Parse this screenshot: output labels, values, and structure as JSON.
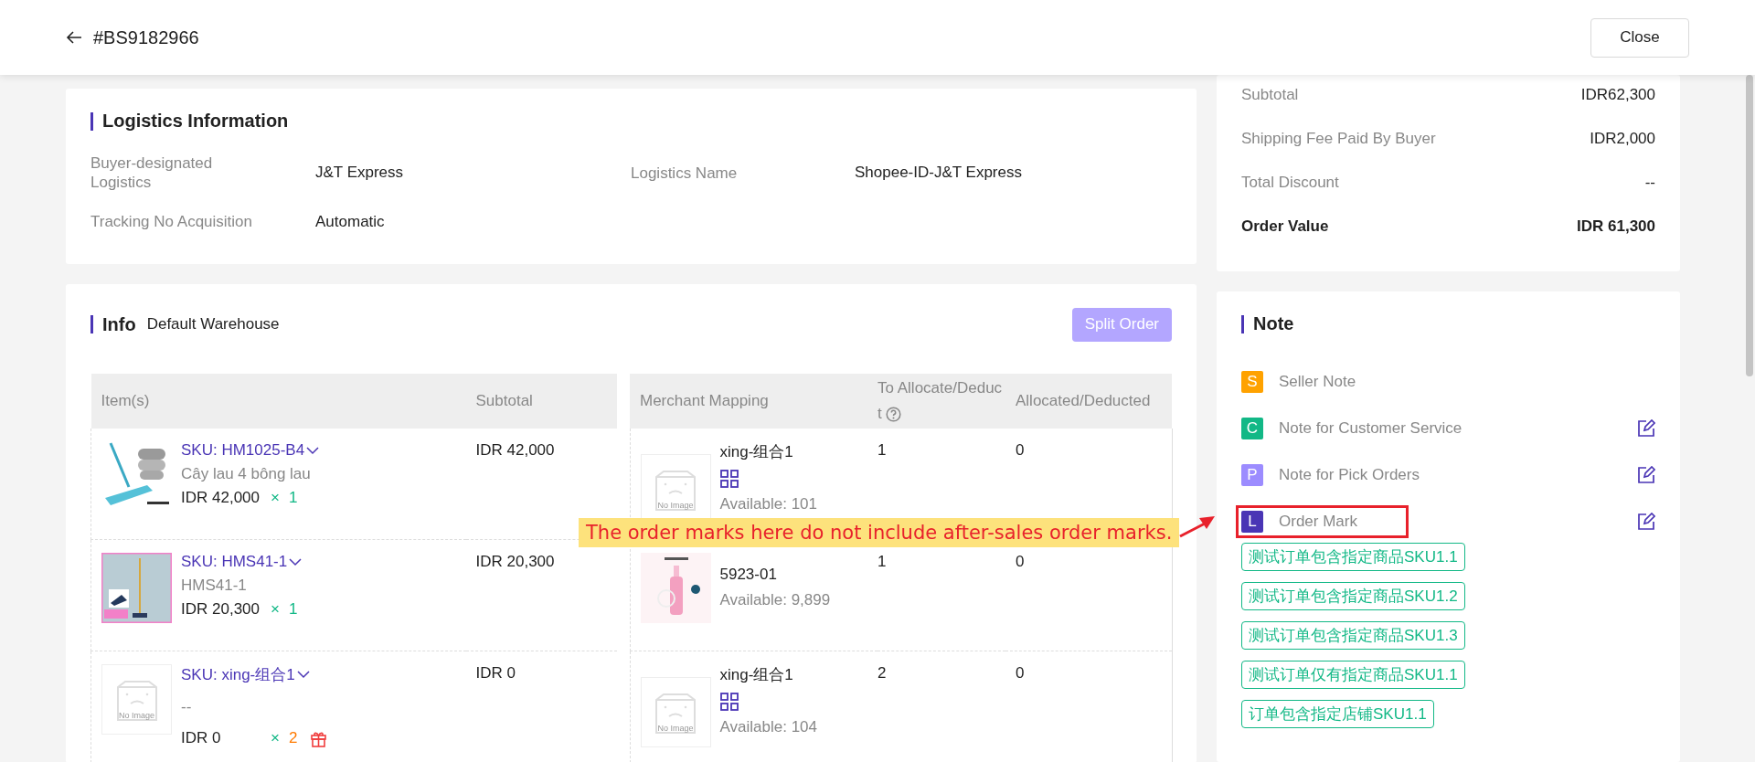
{
  "header": {
    "title": "#BS9182966",
    "close_button": "Close"
  },
  "logistics": {
    "title": "Logistics Information",
    "fields": [
      {
        "label": "Buyer-designated Logistics",
        "value": "J&T Express"
      },
      {
        "label": "Logistics Name",
        "value": "Shopee-ID-J&T Express"
      },
      {
        "label": "Tracking No Acquisition",
        "value": "Automatic"
      }
    ]
  },
  "info": {
    "title": "Info",
    "warehouse": "Default Warehouse",
    "split_button": {
      "label": "Split Order",
      "disabled": true
    },
    "items_table": {
      "columns": [
        "Item(s)",
        "Subtotal"
      ],
      "rows": [
        {
          "kind": "picture",
          "sku": "SKU: HM1025-B4",
          "name": "Cây lau 4 bông lau",
          "price": "IDR 42,000",
          "times": "×",
          "qty": "1",
          "gift": false,
          "subtotal": "IDR 42,000"
        },
        {
          "kind": "picture",
          "sku": "SKU: HMS41-1",
          "name": "HMS41-1",
          "price": "IDR 20,300",
          "times": "×",
          "qty": "1",
          "gift": false,
          "subtotal": "IDR 20,300"
        },
        {
          "kind": "placeholder",
          "placeholder": "No Image",
          "sku": "SKU: xing-组合1",
          "name": "--",
          "price": "IDR 0",
          "times": "×",
          "qty": "2",
          "gift": true,
          "subtotal": "IDR 0"
        }
      ]
    },
    "mapping_table": {
      "columns": [
        "Merchant Mapping",
        "To Allocate/Deduct",
        "Allocated/Deducted"
      ],
      "rows": [
        {
          "kind": "placeholder",
          "placeholder": "No Image",
          "name": "xing-组合1",
          "combo": true,
          "available": "Available: 101",
          "to_allocate": "1",
          "allocated": "0"
        },
        {
          "kind": "picture",
          "name": "5923-01",
          "combo": false,
          "available": "Available: 9,899",
          "to_allocate": "1",
          "allocated": "0"
        },
        {
          "kind": "placeholder",
          "placeholder": "No Image",
          "name": "xing-组合1",
          "combo": true,
          "available": "Available: 104",
          "to_allocate": "2",
          "allocated": "0"
        }
      ]
    }
  },
  "summary": {
    "rows": [
      {
        "label": "Subtotal",
        "value": "IDR62,300",
        "emphasis": false
      },
      {
        "label": "Shipping Fee Paid By Buyer",
        "value": "IDR2,000",
        "emphasis": false
      },
      {
        "label": "Total Discount",
        "value": "--",
        "emphasis": false
      },
      {
        "label": "Order Value",
        "value": "IDR 61,300",
        "emphasis": true
      }
    ]
  },
  "note": {
    "title": "Note",
    "items": [
      {
        "badge": "S",
        "color": "#ffa200",
        "label": "Seller Note",
        "editable": false
      },
      {
        "badge": "C",
        "color": "#12b886",
        "label": "Note for Customer Service",
        "editable": true
      },
      {
        "badge": "P",
        "color": "#9c8cff",
        "label": "Note for Pick Orders",
        "editable": true
      },
      {
        "badge": "L",
        "color": "#4a35b5",
        "label": "Order Mark",
        "editable": true,
        "highlighted": true
      }
    ],
    "marks": [
      "测试订单包含指定商品SKU1.1",
      "测试订单包含指定商品SKU1.2",
      "测试订单包含指定商品SKU1.3",
      "测试订单仅有指定商品SKU1.1",
      "订单包含指定店铺SKU1.1"
    ]
  },
  "annotation": {
    "text": "The order marks here do not include after-sales order marks."
  }
}
